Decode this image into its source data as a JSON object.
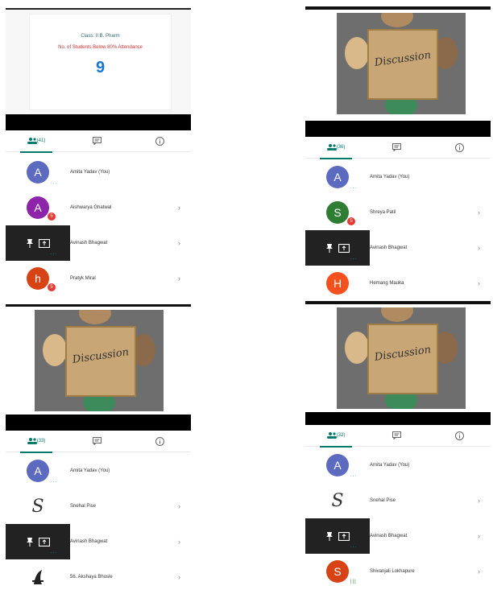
{
  "panels": [
    {
      "slide": {
        "class_line": "Class: II B. Pharm",
        "heading": "No. of Students Below 80% Attendance",
        "value": "9"
      },
      "tabs": {
        "people_count": "(41)"
      },
      "participants": [
        {
          "initial": "A",
          "color": "#5c6bc0",
          "name": "Amita Yadav (You)",
          "badge": "",
          "dots": "...",
          "chevron": ""
        },
        {
          "initial": "A",
          "color": "#8e24aa",
          "name": "Aishwarya Ghatwal",
          "badge": "5",
          "dots": "",
          "chevron": "›"
        },
        {
          "initial": "",
          "color": "#222222",
          "name": "Avinash Bhagwat",
          "badge": "",
          "dots": "...",
          "chevron": "›",
          "presenting": true
        },
        {
          "initial": "h",
          "color": "#d84315",
          "name": "Pratyk Miral",
          "badge": "5",
          "dots": "",
          "chevron": "›"
        }
      ]
    },
    {
      "photo": {
        "label": "Discussion"
      },
      "tabs": {
        "people_count": "(36)"
      },
      "participants": [
        {
          "initial": "A",
          "color": "#5c6bc0",
          "name": "Amita Yadav (You)",
          "badge": "",
          "dots": "...",
          "chevron": ""
        },
        {
          "initial": "S",
          "color": "#2e7d32",
          "name": "Shreya Patil",
          "badge": "5",
          "dots": "",
          "chevron": "›"
        },
        {
          "initial": "",
          "color": "#222222",
          "name": "Avinash Bhagwat",
          "badge": "",
          "dots": "...",
          "chevron": "›",
          "presenting": true
        },
        {
          "initial": "H",
          "color": "#f4511e",
          "name": "Hemang Mauka",
          "badge": "",
          "dots": "",
          "chevron": "›"
        }
      ]
    },
    {
      "photo": {
        "label": "Discussion"
      },
      "tabs": {
        "people_count": "(33)"
      },
      "participants": [
        {
          "initial": "A",
          "color": "#5c6bc0",
          "name": "Amita Yadav (You)",
          "badge": "",
          "dots": "...",
          "chevron": ""
        },
        {
          "initial": "S",
          "color": "script",
          "name": "Snehal Pise",
          "badge": "",
          "dots": "",
          "chevron": "›"
        },
        {
          "initial": "",
          "color": "#222222",
          "name": "Avinash Bhagwat",
          "badge": "",
          "dots": "...",
          "chevron": "›",
          "presenting": true
        },
        {
          "initial": "",
          "color": "icon",
          "name": "56. Akshaya Bhosle",
          "badge": "",
          "dots": "",
          "chevron": "›"
        }
      ]
    },
    {
      "photo": {
        "label": "Discussion"
      },
      "tabs": {
        "people_count": "(32)"
      },
      "participants": [
        {
          "initial": "A",
          "color": "#5c6bc0",
          "name": "Amita Yadav (You)",
          "badge": "",
          "dots": "...",
          "chevron": ""
        },
        {
          "initial": "S",
          "color": "script",
          "name": "Snehal Pise",
          "badge": "",
          "dots": "",
          "chevron": "›"
        },
        {
          "initial": "",
          "color": "#222222",
          "name": "Avinash Bhagwat",
          "badge": "",
          "dots": "...",
          "chevron": "›",
          "presenting": true
        },
        {
          "initial": "S",
          "color": "#d84315",
          "name": "Shivanjali Lokhapure",
          "badge": "",
          "dots": "|||",
          "chevron": "›"
        }
      ]
    }
  ]
}
